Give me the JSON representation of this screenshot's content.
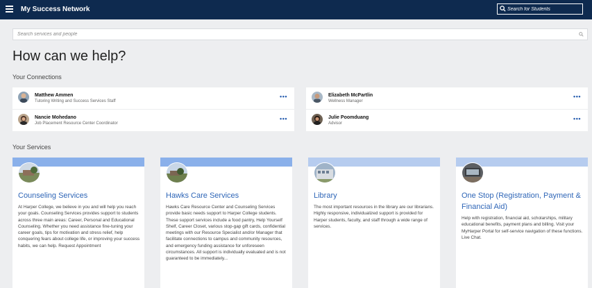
{
  "app": {
    "title": "My Success Network"
  },
  "header_search": {
    "placeholder": "Search for Students"
  },
  "main_search": {
    "placeholder": "Search services and people"
  },
  "heading": "How can we help?",
  "connections": {
    "label": "Your Connections",
    "left": [
      {
        "name": "Matthew Ammen",
        "role": "Tutoring Writing and Success Services Staff",
        "more": "•••"
      },
      {
        "name": "Nancie Mohedano",
        "role": "Job Placement Resource Center Coordinator",
        "more": "•••"
      }
    ],
    "right": [
      {
        "name": "Elizabeth McPartlin",
        "role": "Wellness Manager",
        "more": "•••"
      },
      {
        "name": "Julie Poomduang",
        "role": "Advisor",
        "more": "•••"
      }
    ]
  },
  "services": {
    "label": "Your Services",
    "items": [
      {
        "title": "Counseling Services",
        "description": "At Harper College, we believe in you and will help you reach your goals. Counseling Services provides support to students across three main areas: Career, Personal and Educational Counseling. Whether you need assistance fine-tuning your career goals, tips for motivation and stress relief, help conquering fears about college life, or improving your success habits, we can help. Request Appointment"
      },
      {
        "title": "Hawks Care Services",
        "description": "Hawks Care Resource Center and Counseling Services provide basic needs support to Harper College students. These support services include a food pantry, Help Yourself Shelf, Career Closet, various stop-gap gift cards, confidential meetings with our Resource Specialist and/or Manager that facilitate connections to campus and community resources, and emergency funding assistance for unforeseen circumstances. All support is individually evaluated and is not guaranteed to be immediately..."
      },
      {
        "title": "Library",
        "description": "The most important resources in the library are our librarians. Highly responsive, individualized support is provided for Harper students, faculty, and staff through a wide range of services."
      },
      {
        "title": "One Stop (Registration, Payment & Financial Aid)",
        "description": "Help with registration, financial aid, scholarships, military educational benefits, payment plans and billing. Visit your MyHarper Portal for self-service navigation of these functions. Live Chat."
      }
    ]
  },
  "colors": {
    "header": "#0e2a4f",
    "accent": "#2f66b7",
    "band": "#8ab0ea"
  },
  "icons": {
    "menu": "hamburger-menu-icon",
    "search": "search-icon",
    "more": "more-options-icon"
  }
}
